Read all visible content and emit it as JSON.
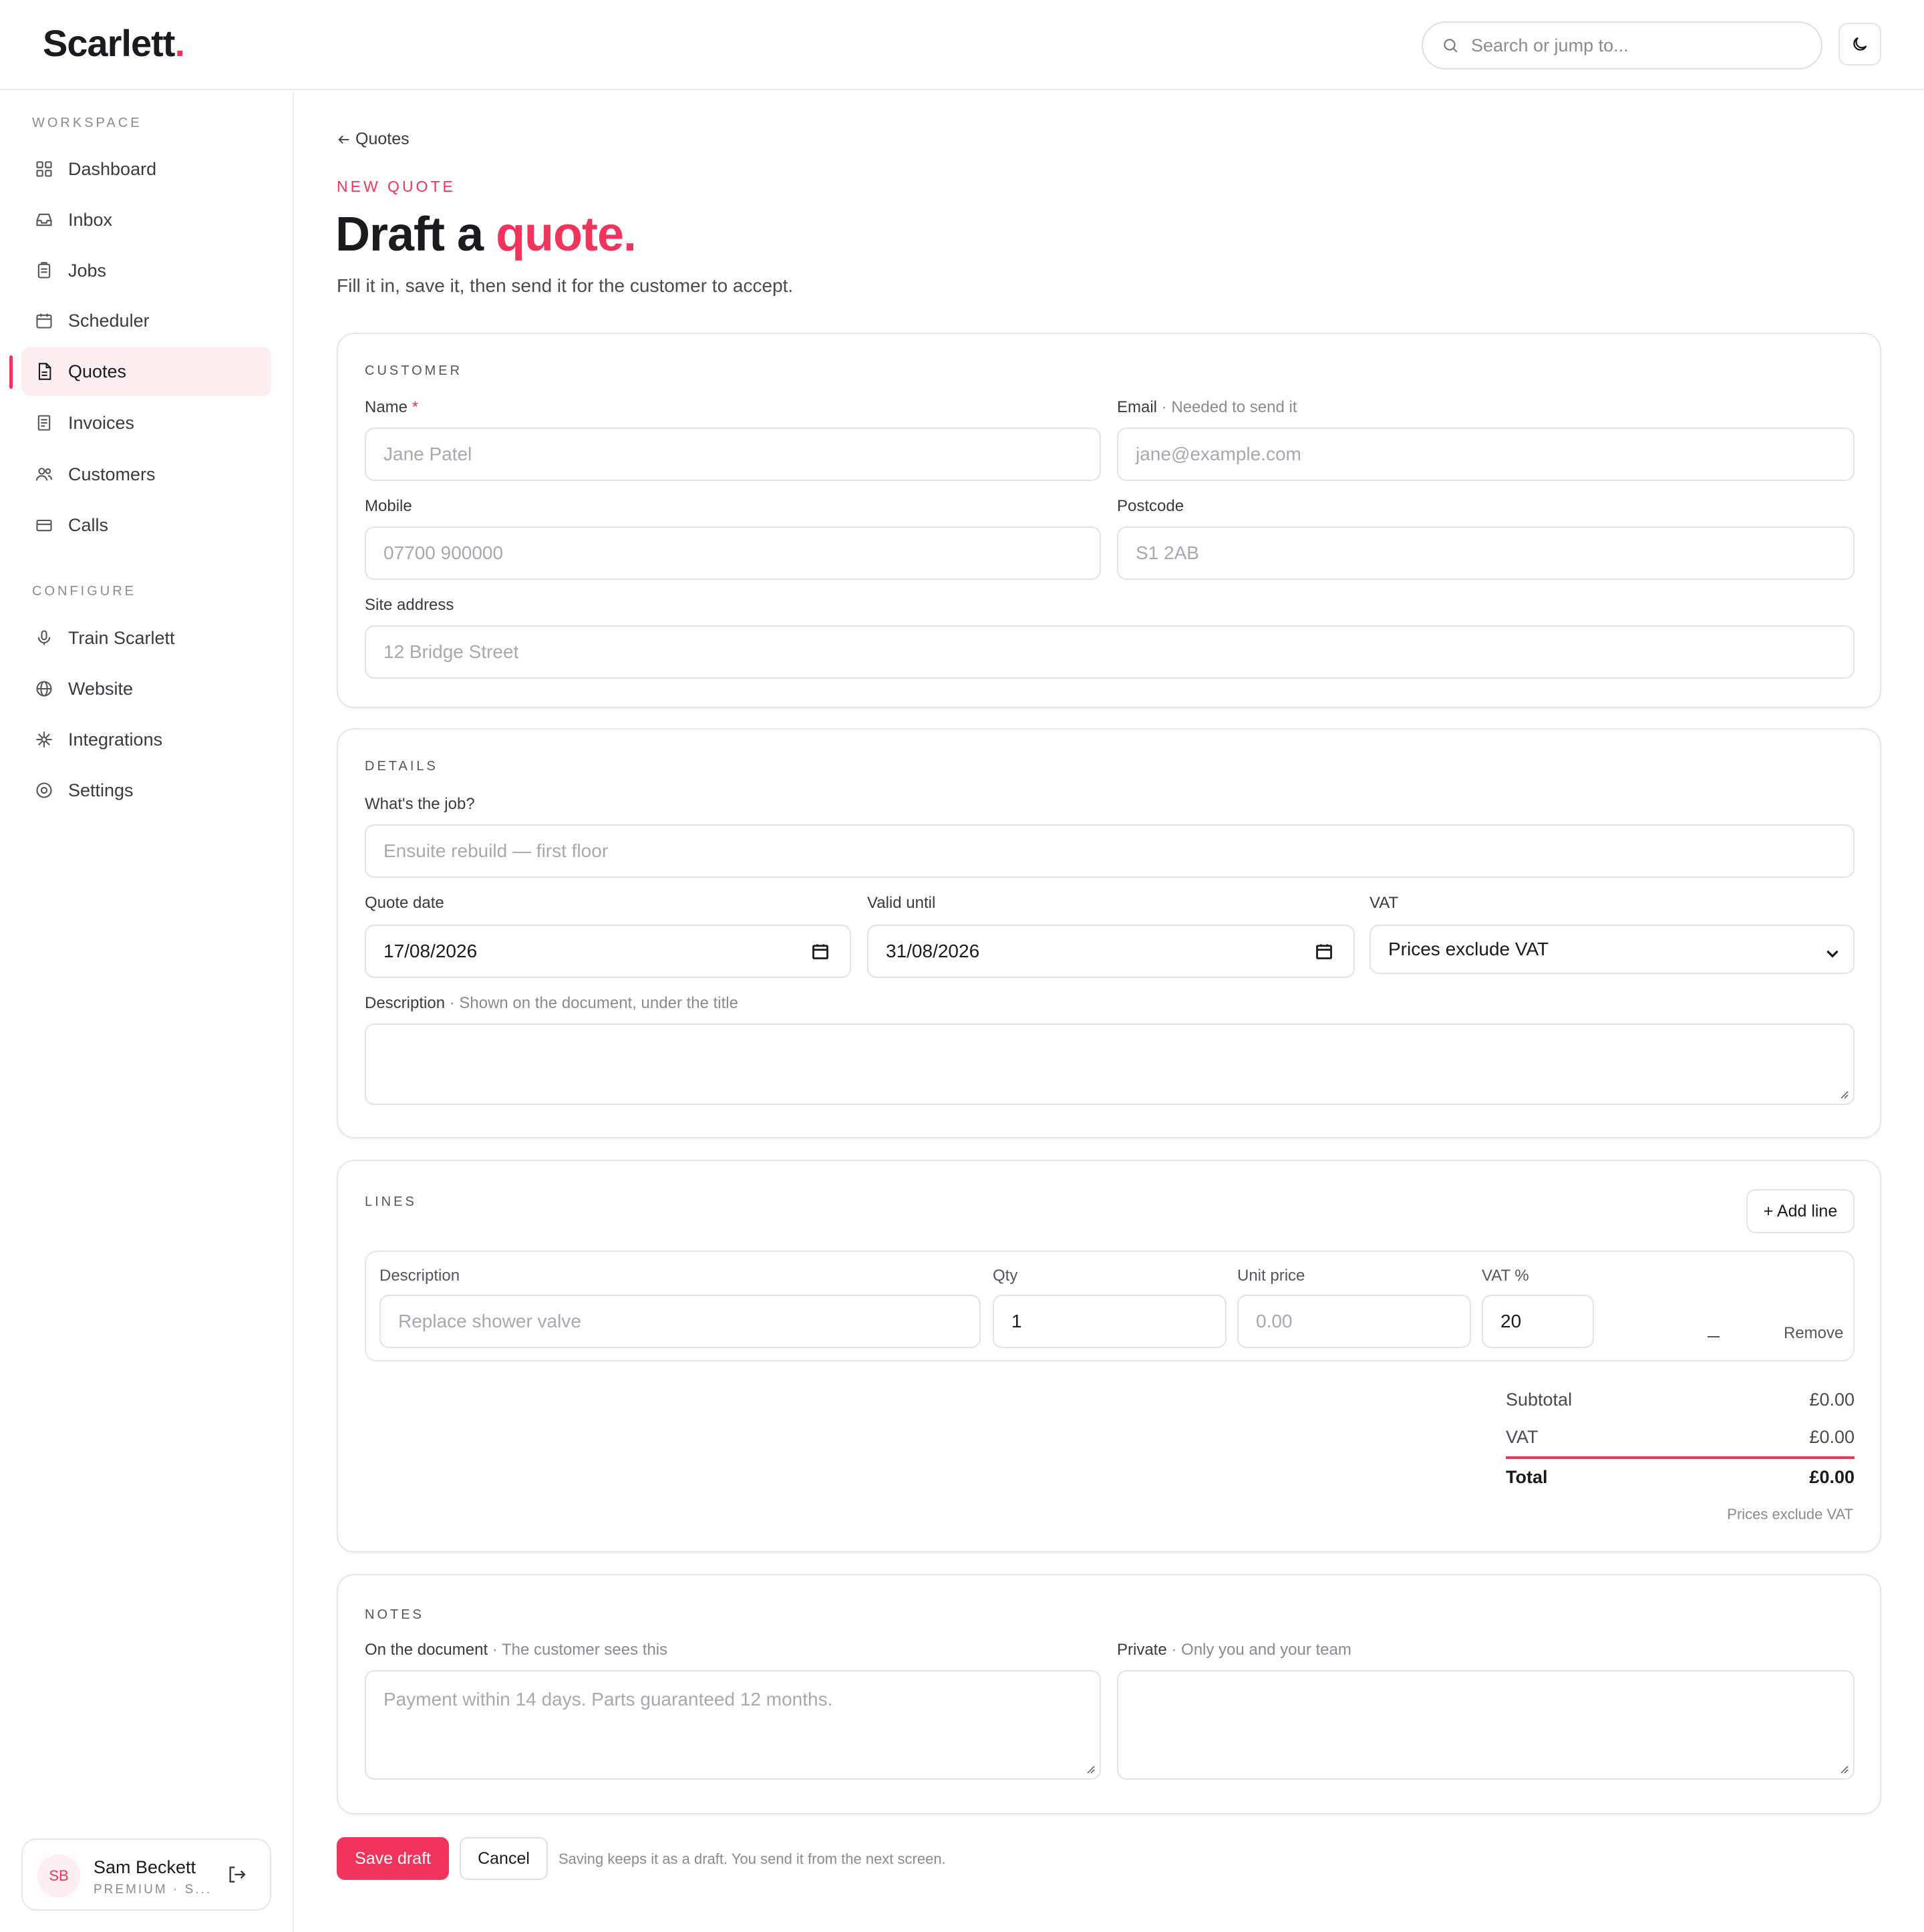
{
  "app": {
    "logo_text": "Scarlett",
    "logo_dot": "."
  },
  "search": {
    "placeholder": "Search or jump to..."
  },
  "sidebar": {
    "workspace_label": "WORKSPACE",
    "workspace_items": [
      {
        "label": "Dashboard",
        "icon": "grid-icon"
      },
      {
        "label": "Inbox",
        "icon": "inbox-icon"
      },
      {
        "label": "Jobs",
        "icon": "clipboard-icon"
      },
      {
        "label": "Scheduler",
        "icon": "calendar-icon"
      },
      {
        "label": "Quotes",
        "icon": "document-icon",
        "active": true
      },
      {
        "label": "Invoices",
        "icon": "receipt-icon"
      },
      {
        "label": "Customers",
        "icon": "users-icon"
      },
      {
        "label": "Calls",
        "icon": "phone-icon"
      }
    ],
    "configure_label": "CONFIGURE",
    "configure_items": [
      {
        "label": "Train Scarlett",
        "icon": "microphone-icon"
      },
      {
        "label": "Website",
        "icon": "globe-icon"
      },
      {
        "label": "Integrations",
        "icon": "sparkle-icon"
      },
      {
        "label": "Settings",
        "icon": "settings-icon"
      }
    ],
    "user": {
      "initials": "SB",
      "name": "Sam Beckett",
      "plan": "PREMIUM · S..."
    }
  },
  "page": {
    "back_label": "Quotes",
    "eyebrow": "NEW QUOTE",
    "title_main": "Draft a ",
    "title_accent": "quote.",
    "subtitle": "Fill it in, save it, then send it for the customer to accept."
  },
  "customer": {
    "section_label": "CUSTOMER",
    "name_label": "Name",
    "name_required": "*",
    "name_placeholder": "Jane Patel",
    "email_label": "Email",
    "email_hint": " · Needed to send it",
    "email_placeholder": "jane@example.com",
    "mobile_label": "Mobile",
    "mobile_placeholder": "07700 900000",
    "postcode_label": "Postcode",
    "postcode_placeholder": "S1 2AB",
    "address_label": "Site address",
    "address_placeholder": "12 Bridge Street"
  },
  "details": {
    "section_label": "DETAILS",
    "job_label": "What's the job?",
    "job_placeholder": "Ensuite rebuild — first floor",
    "quote_date_label": "Quote date",
    "quote_date_value": "17/08/2026",
    "valid_until_label": "Valid until",
    "valid_until_value": "31/08/2026",
    "vat_label": "VAT",
    "vat_value": "Prices exclude VAT",
    "description_label": "Description",
    "description_hint": " · Shown on the document, under the title"
  },
  "lines": {
    "section_label": "LINES",
    "add_line_label": "+ Add line",
    "columns": {
      "description": "Description",
      "qty": "Qty",
      "unit_price": "Unit price",
      "vat_pct": "VAT %"
    },
    "rows": [
      {
        "description_placeholder": "Replace shower valve",
        "qty": "1",
        "unit_price_placeholder": "0.00",
        "vat_pct": "20",
        "dash": "–",
        "remove_label": "Remove"
      }
    ],
    "subtotal_label": "Subtotal",
    "subtotal_value": "£0.00",
    "vat_label": "VAT",
    "vat_value": "£0.00",
    "total_label": "Total",
    "total_value": "£0.00",
    "vat_note": "Prices exclude VAT"
  },
  "notes": {
    "section_label": "NOTES",
    "doc_label": "On the document",
    "doc_hint": " · The customer sees this",
    "doc_placeholder": "Payment within 14 days. Parts guaranteed 12 months.",
    "private_label": "Private",
    "private_hint": " · Only you and your team"
  },
  "actions": {
    "save_label": "Save draft",
    "cancel_label": "Cancel",
    "note": "Saving keeps it as a draft. You send it from the next screen."
  },
  "colors": {
    "accent": "#f0345c",
    "border": "#e6e6ea",
    "muted": "#8a8a92"
  }
}
